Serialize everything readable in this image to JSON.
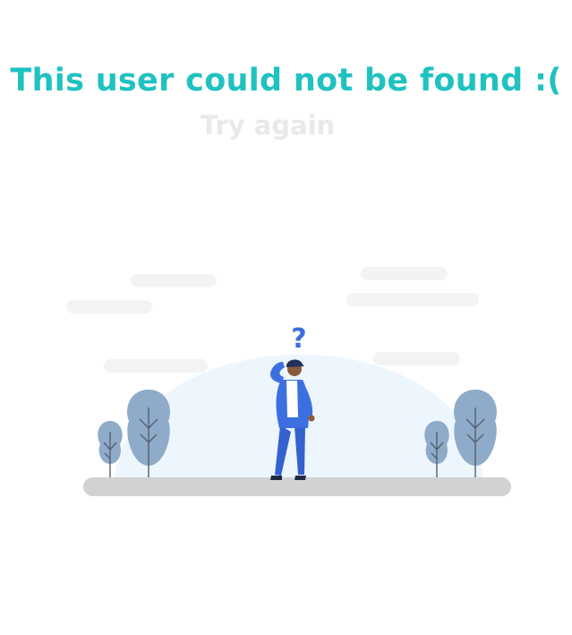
{
  "message": {
    "title": "This user could not be found :(",
    "retry_label": "Try again"
  },
  "illustration": {
    "question_mark": "?"
  },
  "colors": {
    "accent": "#1fc2c1",
    "muted": "#e9e9ea",
    "ground": "#d2d2d2",
    "dome": "#edf5fd",
    "tree": "#8eabc9",
    "figure": "#3c6fe0",
    "cloud": "#f3f3f3"
  }
}
